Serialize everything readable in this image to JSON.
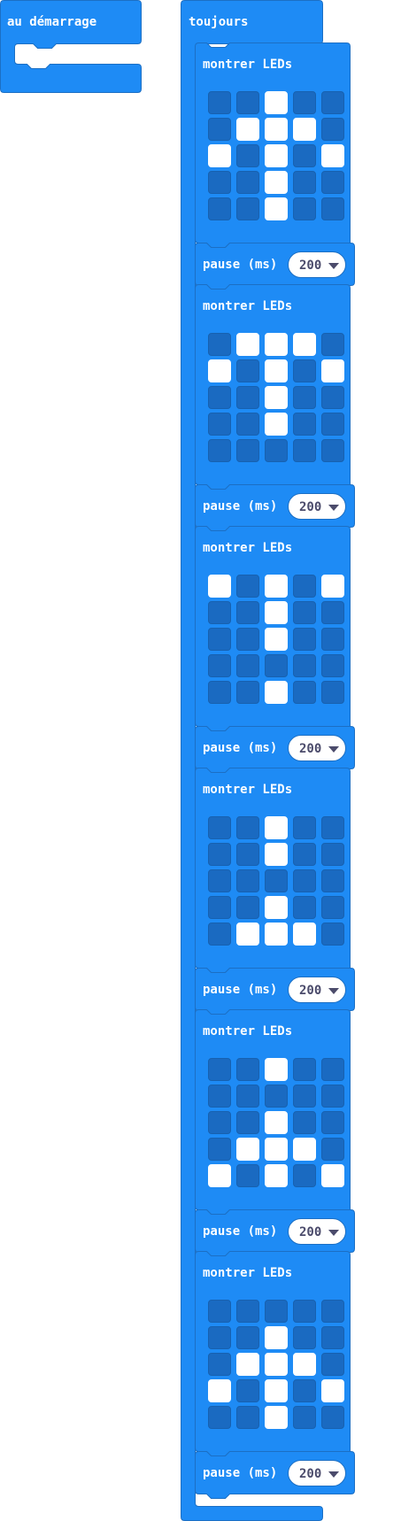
{
  "colors": {
    "block_fill": "#1e8bf5",
    "block_stroke": "#1c6fc4",
    "led_off": "#1a6ac1",
    "led_on": "#ffffff",
    "dropdown_text": "#4b4b6b"
  },
  "on_start": {
    "label": "au démarrage"
  },
  "forever": {
    "label": "toujours",
    "steps": [
      {
        "show_leds_label": "montrer LEDs",
        "leds": [
          [
            0,
            0,
            1,
            0,
            0
          ],
          [
            0,
            1,
            1,
            1,
            0
          ],
          [
            1,
            0,
            1,
            0,
            1
          ],
          [
            0,
            0,
            1,
            0,
            0
          ],
          [
            0,
            0,
            1,
            0,
            0
          ]
        ],
        "pause_label": "pause (ms)",
        "pause_value": "200"
      },
      {
        "show_leds_label": "montrer LEDs",
        "leds": [
          [
            0,
            1,
            1,
            1,
            0
          ],
          [
            1,
            0,
            1,
            0,
            1
          ],
          [
            0,
            0,
            1,
            0,
            0
          ],
          [
            0,
            0,
            1,
            0,
            0
          ],
          [
            0,
            0,
            0,
            0,
            0
          ]
        ],
        "pause_label": "pause (ms)",
        "pause_value": "200"
      },
      {
        "show_leds_label": "montrer LEDs",
        "leds": [
          [
            1,
            0,
            1,
            0,
            1
          ],
          [
            0,
            0,
            1,
            0,
            0
          ],
          [
            0,
            0,
            1,
            0,
            0
          ],
          [
            0,
            0,
            0,
            0,
            0
          ],
          [
            0,
            0,
            1,
            0,
            0
          ]
        ],
        "pause_label": "pause (ms)",
        "pause_value": "200"
      },
      {
        "show_leds_label": "montrer LEDs",
        "leds": [
          [
            0,
            0,
            1,
            0,
            0
          ],
          [
            0,
            0,
            1,
            0,
            0
          ],
          [
            0,
            0,
            0,
            0,
            0
          ],
          [
            0,
            0,
            1,
            0,
            0
          ],
          [
            0,
            1,
            1,
            1,
            0
          ]
        ],
        "pause_label": "pause (ms)",
        "pause_value": "200"
      },
      {
        "show_leds_label": "montrer LEDs",
        "leds": [
          [
            0,
            0,
            1,
            0,
            0
          ],
          [
            0,
            0,
            0,
            0,
            0
          ],
          [
            0,
            0,
            1,
            0,
            0
          ],
          [
            0,
            1,
            1,
            1,
            0
          ],
          [
            1,
            0,
            1,
            0,
            1
          ]
        ],
        "pause_label": "pause (ms)",
        "pause_value": "200"
      },
      {
        "show_leds_label": "montrer LEDs",
        "leds": [
          [
            0,
            0,
            0,
            0,
            0
          ],
          [
            0,
            0,
            1,
            0,
            0
          ],
          [
            0,
            1,
            1,
            1,
            0
          ],
          [
            1,
            0,
            1,
            0,
            1
          ],
          [
            0,
            0,
            1,
            0,
            0
          ]
        ],
        "pause_label": "pause (ms)",
        "pause_value": "200"
      }
    ]
  }
}
